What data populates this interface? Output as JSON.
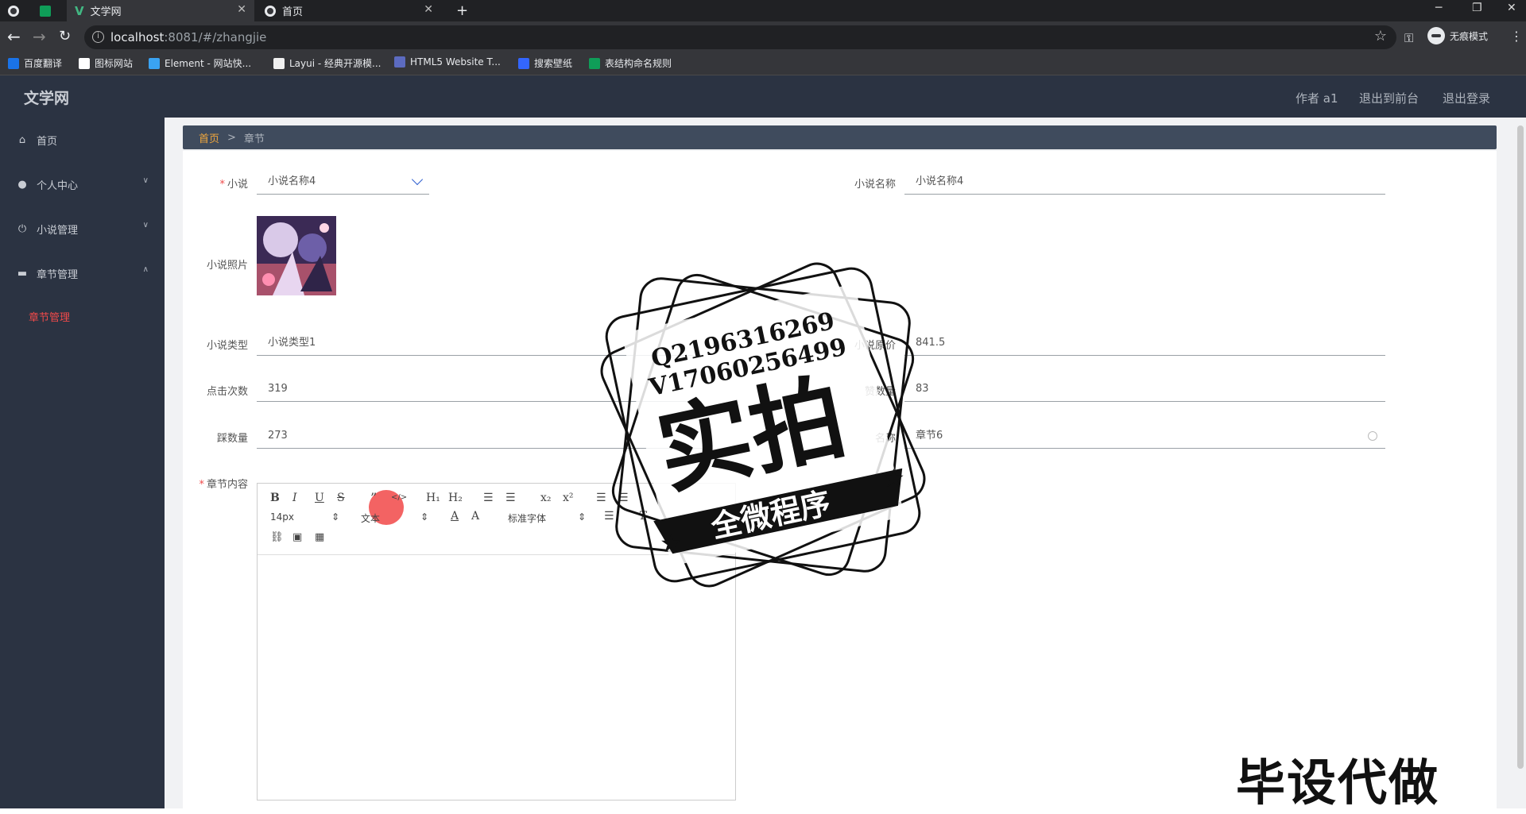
{
  "browser": {
    "tabs": [
      {
        "title": ""
      },
      {
        "title": "文学网"
      },
      {
        "title": "首页"
      }
    ],
    "new_tab": "+",
    "url_host": "localhost",
    "url_rest": ":8081/#/zhangjie",
    "incognito_label": "无痕模式",
    "bookmarks": [
      "百度翻译",
      "图标网站",
      "Element - 网站快...",
      "Layui - 经典开源模...",
      "HTML5 Website T...",
      "搜索壁纸",
      "表结构命名规则"
    ],
    "bookmark_colors": [
      "#1a73e8",
      "#ffffff",
      "#3aa3f2",
      "#f0f0f0",
      "#5c6bc0",
      "#3366ff",
      "#0f9d58"
    ]
  },
  "header": {
    "brand": "文学网",
    "links": [
      "作者 a1",
      "退出到前台",
      "退出登录"
    ]
  },
  "sidebar": {
    "items": [
      {
        "label": "首页",
        "icon": "home-icon"
      },
      {
        "label": "个人中心",
        "icon": "user-icon"
      },
      {
        "label": "小说管理",
        "icon": "power-icon"
      },
      {
        "label": "章节管理",
        "icon": "chat-icon"
      }
    ],
    "active_sub": "章节管理",
    "active_color": "#f04a4a"
  },
  "breadcrumb": {
    "home": "首页",
    "separator": ">",
    "current": "章节"
  },
  "form": {
    "novel_label": "小说",
    "novel_value": "小说名称4",
    "novel_name_label": "小说名称",
    "novel_name_value": "小说名称4",
    "photo_label": "小说照片",
    "type_label": "小说类型",
    "type_value": "小说类型1",
    "price_label": "小说原价",
    "price_value": "841.5",
    "clicks_label": "点击次数",
    "clicks_value": "319",
    "likes_label": "赞数量",
    "likes_value": "83",
    "dislikes_label": "踩数量",
    "dislikes_value": "273",
    "chapter_name_label": "名称",
    "chapter_name_value": "章节6",
    "content_label": "章节内容"
  },
  "editor": {
    "font_size": "14px",
    "text_style": "文本",
    "font_family": "标准字体"
  },
  "watermark": {
    "line1": "Q2196316269",
    "line2": "V17060256499",
    "main": "实拍",
    "banner": "全微程序",
    "corner": "毕设代做"
  }
}
